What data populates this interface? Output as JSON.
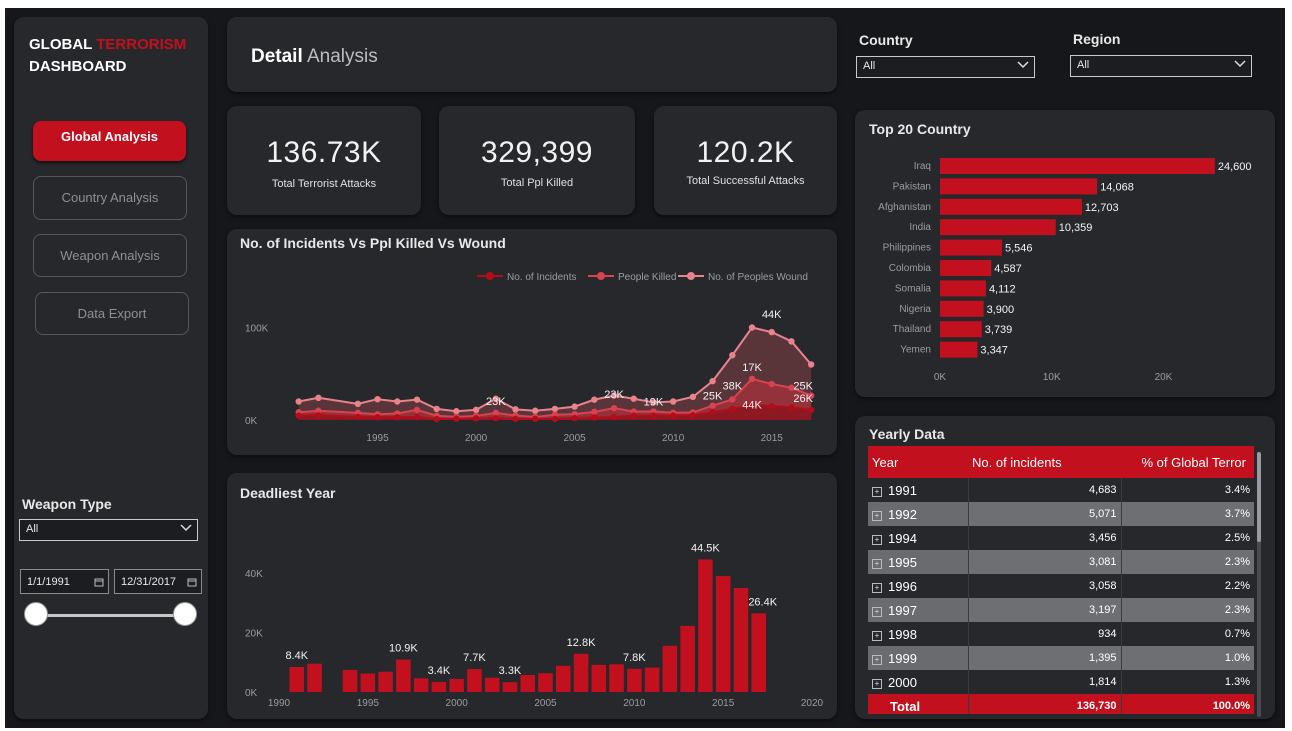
{
  "sidebar": {
    "title_part1": "GLOBAL ",
    "title_part2": "TERRORISM",
    "title_line2": "DASHBOARD",
    "nav": [
      {
        "label": "Global Analysis",
        "active": true
      },
      {
        "label": "Country Analysis",
        "active": false
      },
      {
        "label": "Weapon Analysis",
        "active": false
      },
      {
        "label": "Data Export",
        "active": false
      }
    ],
    "weapon_type_label": "Weapon Type",
    "weapon_type_value": "All",
    "date_start": "1/1/1991",
    "date_end": "12/31/2017"
  },
  "header": {
    "title_bold": "Detail",
    "title_rest": " Analysis"
  },
  "filters": {
    "country_label": "Country",
    "country_value": "All",
    "region_label": "Region",
    "region_value": "All"
  },
  "kpis": [
    {
      "value": "136.73K",
      "label": "Total Terrorist Attacks"
    },
    {
      "value": "329,399",
      "label": "Total Ppl Killed"
    },
    {
      "value": "120.2K",
      "label": "Total Successful Attacks"
    }
  ],
  "colors": {
    "accent": "#c2101e",
    "panel": "#26282c",
    "bg": "#16171a"
  },
  "chart_data": [
    {
      "id": "incidents_line",
      "type": "area",
      "title": "No. of Incidents Vs Ppl Killed Vs Wound",
      "legend_position": "top-right",
      "x_ticks": [
        1995,
        2000,
        2005,
        2010,
        2015
      ],
      "y_ticks": [
        "0K",
        "100K"
      ],
      "ylim": [
        0,
        120000
      ],
      "x": [
        1991,
        1992,
        1994,
        1995,
        1996,
        1997,
        1998,
        1999,
        2000,
        2001,
        2002,
        2003,
        2004,
        2005,
        2006,
        2007,
        2008,
        2009,
        2010,
        2011,
        2012,
        2013,
        2014,
        2015,
        2016,
        2017
      ],
      "series": [
        {
          "name": "No. of Incidents",
          "color": "#b30d1b",
          "values": [
            4683,
            5071,
            3456,
            3081,
            3058,
            3197,
            934,
            1395,
            1814,
            1906,
            1333,
            1278,
            1166,
            2017,
            2758,
            3242,
            4805,
            4721,
            4826,
            5076,
            8522,
            12036,
            16903,
            14965,
            13587,
            10900
          ]
        },
        {
          "name": "People Killed",
          "color": "#d94250",
          "values": [
            8400,
            10000,
            7700,
            6200,
            7000,
            10900,
            4600,
            3400,
            4400,
            7700,
            4800,
            3300,
            5700,
            6300,
            8800,
            12800,
            9100,
            9300,
            7800,
            8200,
            15500,
            22200,
            44500,
            38900,
            34900,
            26400
          ]
        },
        {
          "name": "No. of Peoples Wound",
          "color": "#e8838c",
          "values": [
            20000,
            24000,
            17500,
            22500,
            20000,
            22000,
            12000,
            9500,
            11000,
            23000,
            11500,
            10000,
            12000,
            14500,
            22000,
            26500,
            23000,
            19000,
            20000,
            25000,
            42000,
            70000,
            100000,
            95000,
            85000,
            60000
          ]
        }
      ],
      "point_labels": [
        {
          "year": 2001,
          "text": "23K"
        },
        {
          "year": 2007,
          "text": "23K"
        },
        {
          "year": 2009,
          "text": "19K"
        },
        {
          "year": 2012,
          "text": "25K"
        },
        {
          "year": 2013,
          "text": "38K"
        },
        {
          "year": 2014,
          "text": "44K"
        },
        {
          "year": 2014,
          "text": "17K"
        },
        {
          "year": 2015,
          "text": "44K"
        },
        {
          "year": 2017,
          "text": "25K"
        },
        {
          "year": 2017,
          "text": "26K"
        }
      ]
    },
    {
      "id": "deadliest_year",
      "type": "bar",
      "title": "Deadliest Year",
      "x_ticks": [
        1990,
        1995,
        2000,
        2005,
        2010,
        2015,
        2020
      ],
      "y_ticks": [
        "0K",
        "20K",
        "40K"
      ],
      "ylim": [
        0,
        50000
      ],
      "categories": [
        1991,
        1992,
        1994,
        1995,
        1996,
        1997,
        1998,
        1999,
        2000,
        2001,
        2002,
        2003,
        2004,
        2005,
        2006,
        2007,
        2008,
        2009,
        2010,
        2011,
        2012,
        2013,
        2014,
        2015,
        2016,
        2017
      ],
      "values": [
        8400,
        9500,
        7400,
        6200,
        6800,
        10900,
        4600,
        3400,
        4400,
        7700,
        4800,
        3300,
        5700,
        6300,
        8800,
        12800,
        9100,
        9300,
        7800,
        8200,
        15500,
        22200,
        44500,
        38900,
        34900,
        26400
      ],
      "data_labels": {
        "1991": "8.4K",
        "1997": "10.9K",
        "1999": "3.4K",
        "2001": "7.7K",
        "2003": "3.3K",
        "2007": "12.8K",
        "2010": "7.8K",
        "2014": "44.5K",
        "2017": "26.4K"
      }
    },
    {
      "id": "top20",
      "type": "bar",
      "orientation": "horizontal",
      "title": "Top 20 Country",
      "x_ticks": [
        "0K",
        "10K",
        "20K"
      ],
      "xlim": [
        0,
        26000
      ],
      "categories": [
        "Iraq",
        "Pakistan",
        "Afghanistan",
        "India",
        "Philippines",
        "Colombia",
        "Somalia",
        "Nigeria",
        "Thailand",
        "Yemen"
      ],
      "values": [
        24600,
        14068,
        12703,
        10359,
        5546,
        4587,
        4112,
        3900,
        3739,
        3347
      ],
      "value_labels": [
        "24,600",
        "14,068",
        "12,703",
        "10,359",
        "5,546",
        "4,587",
        "4,112",
        "3,900",
        "3,739",
        "3,347"
      ]
    }
  ],
  "yearly": {
    "title": "Yearly Data",
    "headers": [
      "Year",
      "No. of incidents",
      "% of Global Terror"
    ],
    "rows": [
      {
        "year": "1991",
        "incidents": "4,683",
        "pct": "3.4%"
      },
      {
        "year": "1992",
        "incidents": "5,071",
        "pct": "3.7%"
      },
      {
        "year": "1994",
        "incidents": "3,456",
        "pct": "2.5%"
      },
      {
        "year": "1995",
        "incidents": "3,081",
        "pct": "2.3%"
      },
      {
        "year": "1996",
        "incidents": "3,058",
        "pct": "2.2%"
      },
      {
        "year": "1997",
        "incidents": "3,197",
        "pct": "2.3%"
      },
      {
        "year": "1998",
        "incidents": "934",
        "pct": "0.7%"
      },
      {
        "year": "1999",
        "incidents": "1,395",
        "pct": "1.0%"
      },
      {
        "year": "2000",
        "incidents": "1,814",
        "pct": "1.3%"
      }
    ],
    "total": {
      "label": "Total",
      "incidents": "136,730",
      "pct": "100.0%"
    }
  }
}
